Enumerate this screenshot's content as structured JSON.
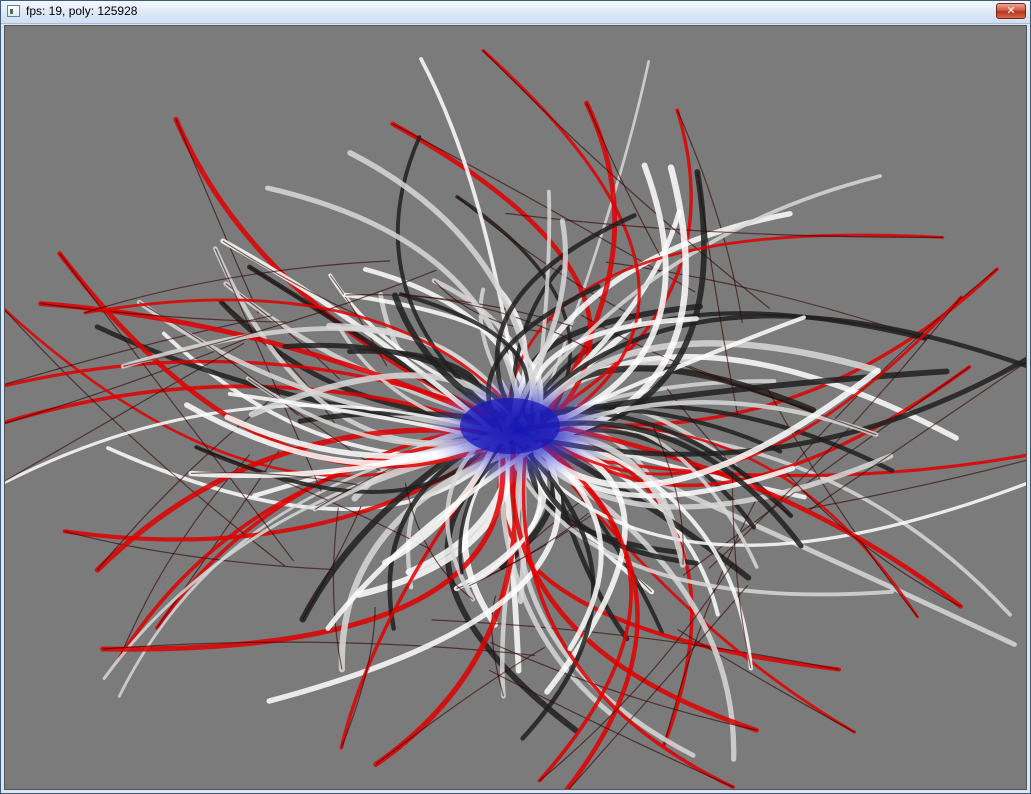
{
  "window": {
    "title": "fps: 19, poly: 125928",
    "close_glyph": "✕",
    "app_icon": "app-window-icon"
  },
  "viewport": {
    "background_color": "#7b7b7b",
    "core_color": "#2020c0",
    "strand_colors": [
      "#ffffff",
      "#d8d8d8",
      "#202020",
      "#e00000"
    ]
  }
}
